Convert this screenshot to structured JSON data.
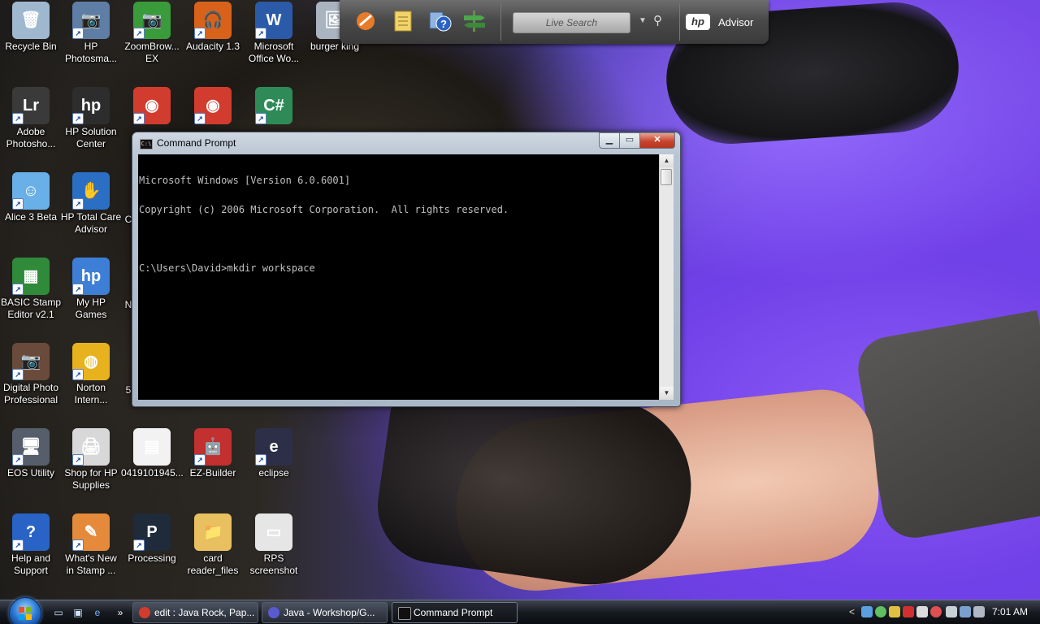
{
  "desktop_icons": [
    {
      "label": "Recycle Bin",
      "icon": "recycle-bin-icon",
      "color": "#9fb8d0",
      "glyph": "🗑"
    },
    {
      "label": "HP Photosma...",
      "icon": "hp-photosmart-icon",
      "color": "#5f7ea6",
      "glyph": "📷"
    },
    {
      "label": "ZoomBrow... EX",
      "icon": "zoombrowser-icon",
      "color": "#3a9b3a",
      "glyph": "📷"
    },
    {
      "label": "Audacity 1.3",
      "icon": "audacity-icon",
      "color": "#d9621b",
      "glyph": "🎧"
    },
    {
      "label": "Microsoft Office Wo...",
      "icon": "word-icon",
      "color": "#2b5aa8",
      "glyph": "W"
    },
    {
      "label": "burger king",
      "icon": "image-file-icon",
      "color": "#a9b4c0",
      "glyph": "🖼"
    },
    {
      "label": "Adobe Photosho...",
      "icon": "lightroom-icon",
      "color": "#3a3a3a",
      "glyph": "Lr"
    },
    {
      "label": "HP Solution Center",
      "icon": "hp-solution-center-icon",
      "color": "#2d2d2d",
      "glyph": "hp"
    },
    {
      "label": "",
      "icon": "chrome-icon",
      "color": "#d23c2e",
      "glyph": "◉"
    },
    {
      "label": "",
      "icon": "chrome-icon",
      "color": "#d23c2e",
      "glyph": "◉"
    },
    {
      "label": "",
      "icon": "csharp-icon",
      "color": "#2e8b57",
      "glyph": "C#"
    },
    {
      "label": "Alice 3 Beta",
      "icon": "alice-icon",
      "color": "#6ab0e8",
      "glyph": "☺"
    },
    {
      "label": "HP Total Care Advisor",
      "icon": "hp-total-care-icon",
      "color": "#2a6fc4",
      "glyph": "✋"
    },
    {
      "label": "BASIC Stamp Editor v2.1",
      "icon": "basic-stamp-icon",
      "color": "#2f8a3a",
      "glyph": "▦"
    },
    {
      "label": "My HP Games",
      "icon": "hp-games-icon",
      "color": "#3d7fd6",
      "glyph": "hp"
    },
    {
      "label": "Digital Photo Professional",
      "icon": "digital-photo-icon",
      "color": "#6a4a3a",
      "glyph": "📷"
    },
    {
      "label": "Norton Intern...",
      "icon": "norton-icon",
      "color": "#e8b21e",
      "glyph": "◍"
    },
    {
      "label": "EOS Utility",
      "icon": "eos-utility-icon",
      "color": "#555e6a",
      "glyph": "🖥"
    },
    {
      "label": "Shop for HP Supplies",
      "icon": "hp-supplies-icon",
      "color": "#d8d8d8",
      "glyph": "🖨"
    },
    {
      "label": "0419101945...",
      "icon": "calendar-file-icon",
      "color": "#f2f2f2",
      "glyph": "▤"
    },
    {
      "label": "EZ-Builder",
      "icon": "ez-builder-icon",
      "color": "#c23030",
      "glyph": "🤖"
    },
    {
      "label": "eclipse",
      "icon": "eclipse-icon",
      "color": "#2d2f48",
      "glyph": "e"
    },
    {
      "label": "Help and Support",
      "icon": "help-icon",
      "color": "#2a63c6",
      "glyph": "?"
    },
    {
      "label": "What's New in Stamp ...",
      "icon": "stamp-news-icon",
      "color": "#e48a3a",
      "glyph": "✎"
    },
    {
      "label": "Processing",
      "icon": "processing-icon",
      "color": "#1f2a3a",
      "glyph": "P"
    },
    {
      "label": "card reader_files",
      "icon": "folder-icon",
      "color": "#e8c060",
      "glyph": "📁"
    },
    {
      "label": "RPS screenshot",
      "icon": "image-file-icon",
      "color": "#e6e6e6",
      "glyph": "▭"
    }
  ],
  "partial_labels": [
    "C",
    "N",
    "5"
  ],
  "toolbar": {
    "search_placeholder": "Live Search",
    "hp_logo": "hp",
    "advisor_label": "Advisor"
  },
  "cmd": {
    "title": "Command Prompt",
    "icon_text": "C:\\",
    "lines": [
      "Microsoft Windows [Version 6.0.6001]",
      "Copyright (c) 2006 Microsoft Corporation.  All rights reserved.",
      "",
      "C:\\Users\\David>mkdir workspace"
    ]
  },
  "taskbar": {
    "tasks": [
      {
        "label": "edit : Java Rock, Pap...",
        "icon_color": "#d23c2e"
      },
      {
        "label": "Java - Workshop/G...",
        "icon_color": "#5a5ad0"
      },
      {
        "label": "Command Prompt",
        "icon_color": "#111111"
      }
    ],
    "quick_launch_more": "»",
    "tray_chevron": "<",
    "clock": "7:01 AM"
  }
}
